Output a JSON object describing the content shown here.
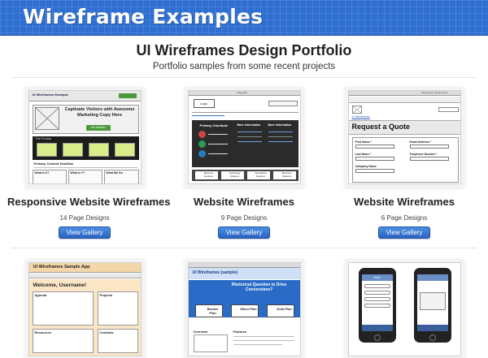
{
  "banner": {
    "title": "Wireframe Examples"
  },
  "header": {
    "title": "UI Wireframes Design Portfolio",
    "subtitle": "Portfolio samples from some recent projects"
  },
  "cards": [
    {
      "title": "Responsive Website Wireframes",
      "count": "14 Page Designs",
      "button": "View Gallery",
      "thumb": {
        "app_title": "UI Wireframes Example",
        "hero_text": "Captivate Visitors with Awesome Marketing Copy Here",
        "hero_button": "Get Started",
        "process_label": "The Process",
        "content_headline": "Primary Content Headline",
        "col_labels": [
          "What is X?",
          "What Is Y?",
          "What We Do"
        ]
      }
    },
    {
      "title": "Website Wireframes",
      "count": "9 Page Designs",
      "button": "View Gallery",
      "thumb": {
        "window_label": "Page title",
        "logo": "Logo",
        "dark_headings": [
          "Primary Omnitude",
          "More Information",
          "More Information"
        ],
        "footer_labels": [
          "Business Features",
          "Technology Features",
          "Specialized Features",
          "Business Features"
        ]
      }
    },
    {
      "title": "Website Wireframes",
      "count": "6 Page Designs",
      "button": "View Gallery",
      "thumb": {
        "window_label": "Request for Quote Form",
        "site_label": "UI Wireframes",
        "heading": "Request a Quote",
        "fields": [
          "First Name *",
          "Email Address *",
          "Last Name *",
          "Telephone Number *",
          "Company Name"
        ]
      }
    },
    {
      "thumb": {
        "app_title": "UI Wireframes Sample App",
        "welcome": "Welcome, Username!",
        "panels": [
          "Agenda",
          "Projects",
          "Resources",
          "Contacts"
        ]
      }
    },
    {
      "thumb": {
        "logo": "UI Wireframes (sample)",
        "question": "Rhetorical Question to Drive Conversions?",
        "plans": [
          "Bronze Plan",
          "Silver Plan",
          "Gold Plan"
        ],
        "sections": [
          "Overview",
          "Features"
        ]
      }
    },
    {
      "thumb": {
        "screen_title": "Store"
      }
    }
  ]
}
